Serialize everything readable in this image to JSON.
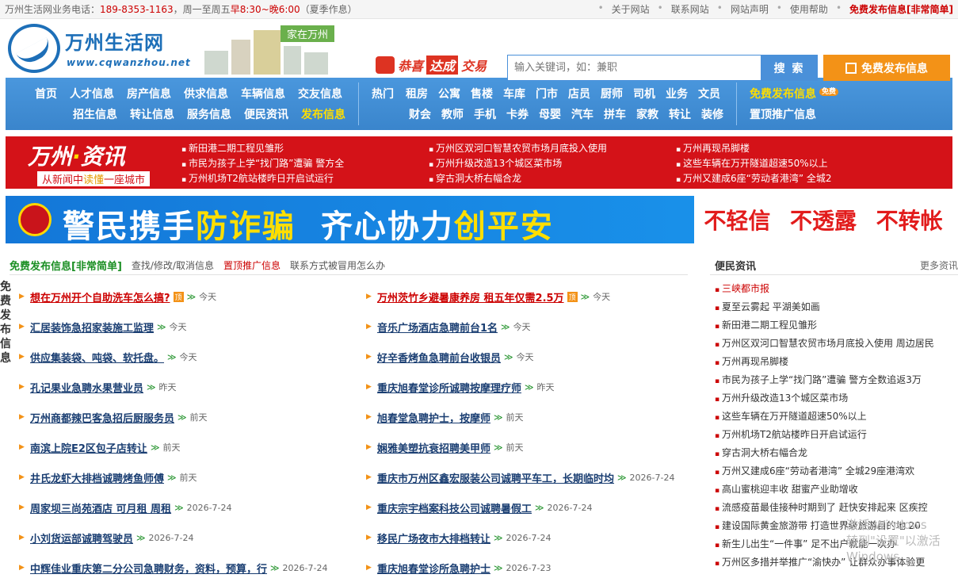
{
  "topbar": {
    "hotline_label": "万州生活网业务电话：",
    "phone": "189-8353-1163",
    "days": "，周一至周五",
    "hours": "早8:30~晚6:00",
    "note": "（夏季作息）",
    "links": [
      "关于网站",
      "联系网站",
      "网站声明",
      "使用帮助"
    ],
    "hot_link": "免费发布信息[非常简单]"
  },
  "header": {
    "logo_name": "万州生活网",
    "logo_url": "www.cqwanzhou.net",
    "city_tag": "家在万州",
    "slogan": [
      "恭喜",
      "达成",
      "交易"
    ],
    "search_placeholder": "输入关键词，如：兼职",
    "search_button": "搜 索",
    "post_button": "免费发布信息"
  },
  "nav": {
    "row1": [
      "首页",
      "人才信息",
      "房产信息",
      "供求信息",
      "车辆信息",
      "交友信息"
    ],
    "row2": [
      "招生信息",
      "转让信息",
      "服务信息",
      "便民资讯",
      "发布信息"
    ],
    "hot_label": "热门",
    "hot_row1": [
      "租房",
      "公寓",
      "售楼",
      "车库",
      "门市",
      "店员",
      "厨师",
      "司机",
      "业务",
      "文员"
    ],
    "hot_row2": [
      "财会",
      "教师",
      "手机",
      "卡券",
      "母婴",
      "汽车",
      "拼车",
      "家教",
      "转让",
      "装修"
    ],
    "free_post": "免费发布信息",
    "free_badge": "免费",
    "top_promo": "置顶推广信息"
  },
  "newsbar": {
    "brand_a": "万州",
    "brand_dot": "·",
    "brand_b": "资讯",
    "sub_a": "从新闻中",
    "sub_b": "读懂",
    "sub_c": "一座城市",
    "col1": [
      "新田港二期工程见雏形",
      "市民为孩子上学“找门路”遭骗 警方全",
      "万州机场T2航站楼昨日开启试运行"
    ],
    "col2": [
      "万州区双河口智慧农贸市场月底投入使用",
      "万州升级改造13个城区菜市场",
      "穿古洞大桥右幅合龙"
    ],
    "col3": [
      "万州再现吊脚楼",
      "这些车辆在万开隧道超速50%以上",
      "万州又建成6座“劳动者港湾” 全城2"
    ]
  },
  "banner": {
    "part1": "警民携手",
    "part2": "防诈骗",
    "part3": "齐心协力",
    "part4": "创平安",
    "warn": [
      "不轻信",
      "不透露",
      "不转帐"
    ]
  },
  "left": {
    "side_tab": "免费发布信息",
    "title": "免费发布信息[非常简单]",
    "links": [
      "查找/修改/取消信息",
      "置顶推广信息",
      "联系方式被冒用怎么办"
    ],
    "items": [
      {
        "title": "想在万州开个自助洗车怎么搞?",
        "time": "今天",
        "top": true
      },
      {
        "title": "万州茨竹乡避暑康养房 租五年仅需2.5万",
        "time": "今天",
        "top": true
      },
      {
        "title": "汇居装饰急招家装施工监理",
        "time": "今天",
        "top": false
      },
      {
        "title": "音乐广场酒店急聘前台1名",
        "time": "今天",
        "top": false
      },
      {
        "title": "供应集装袋、吨袋、软托盘。",
        "time": "今天",
        "top": false
      },
      {
        "title": "好辛香烤鱼急聘前台收银员",
        "time": "今天",
        "top": false
      },
      {
        "title": "孔记果业急聘水果营业员",
        "time": "昨天",
        "top": false
      },
      {
        "title": "重庆旭春堂诊所诚聘按摩理疗师",
        "time": "昨天",
        "top": false
      },
      {
        "title": "万州商都辣巴客急招后厨服务员",
        "time": "前天",
        "top": false
      },
      {
        "title": "旭春堂急聘护士，按摩师",
        "time": "前天",
        "top": false
      },
      {
        "title": "南滨上院E2区包子店转让",
        "time": "前天",
        "top": false
      },
      {
        "title": "娴雅美塑抗衰招聘美甲师",
        "time": "前天",
        "top": false
      },
      {
        "title": "井氏龙虾大排档诚聘烤鱼师傅",
        "time": "前天",
        "top": false
      },
      {
        "title": "重庆市万州区鑫宏服装公司诚聘平车工，长期临时均",
        "time": "2026-7-24",
        "top": false
      },
      {
        "title": "周家坝三尚苑酒店 可月租 周租",
        "time": "2026-7-24",
        "top": false
      },
      {
        "title": "重庆宗宇档案科技公司诚聘暑假工",
        "time": "2026-7-24",
        "top": false
      },
      {
        "title": "小刘货运部诚聘驾驶员",
        "time": "2026-7-24",
        "top": false
      },
      {
        "title": "移民广场夜市大排档转让",
        "time": "2026-7-24",
        "top": false
      },
      {
        "title": "中辉佳业重庆第二分公司急聘财务，资料，预算，行",
        "time": "2026-7-24",
        "top": false
      },
      {
        "title": "重庆旭春堂诊所急聘护士",
        "time": "2026-7-23",
        "top": false
      }
    ],
    "top_badge": "顶",
    "check_glyph": "≫"
  },
  "right": {
    "title": "便民资讯",
    "more": "更多资讯",
    "items": [
      "三峡都市报",
      "夏至云雾起 平湖美如画",
      "新田港二期工程见雏形",
      "万州区双河口智慧农贸市场月底投入使用 周边居民",
      "万州再现吊脚楼",
      "市民为孩子上学“找门路”遭骗 警方全数追返3万",
      "万州升级改造13个城区菜市场",
      "这些车辆在万开隧道超速50%以上",
      "万州机场T2航站楼昨日开启试运行",
      "穿古洞大桥右幅合龙",
      "万州又建成6座“劳动者港湾” 全城29座港湾欢",
      "高山蜜桃迎丰收 甜蜜产业助增收",
      "流感疫苗最佳接种时期到了 赶快安排起来 区疾控",
      "建设国际黄金旅游带 打造世界级旅游目的地 20",
      "新生儿出生“一件事” 足不出户就能一次办",
      "万州区多措并举推广“渝快办” 让群众办事体验更"
    ]
  },
  "watermark": {
    "line1": "激活 Windows",
    "line2": "转到\"设置\"以激活 Windows。"
  },
  "colors": {
    "brand_blue": "#1d6fb8",
    "nav_blue": "#3a85cc",
    "news_red": "#d41218",
    "accent_orange": "#f39217",
    "green": "#1b8f24"
  }
}
